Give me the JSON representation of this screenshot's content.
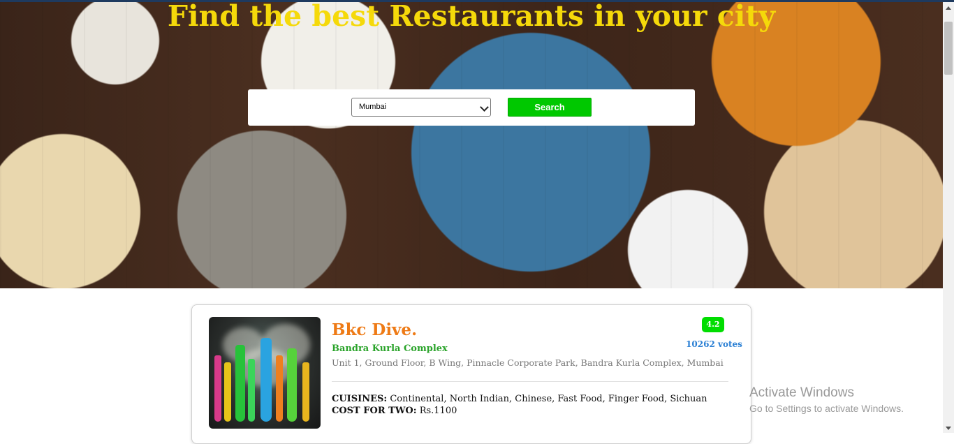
{
  "hero": {
    "title": "Find the best Restaurants in your city"
  },
  "search": {
    "selected_city": "Mumbai",
    "button_label": "Search"
  },
  "restaurant": {
    "name": "Bkc Dive.",
    "area": "Bandra Kurla Complex",
    "address": "Unit 1, Ground Floor, B Wing, Pinnacle Corporate Park, Bandra Kurla Complex, Mumbai",
    "rating": "4.2",
    "votes": "10262 votes",
    "cuisines_label": "CUISINES:",
    "cuisines": "Continental, North Indian, Chinese, Fast Food, Finger Food, Sichuan",
    "cost_label": "COST FOR TWO:",
    "cost": "Rs.1100"
  },
  "os_watermark": {
    "title": "Activate Windows",
    "subtitle": "Go to Settings to activate Windows."
  },
  "colors": {
    "title": "#f5d90a",
    "search_button": "#00c800",
    "restaurant_name": "#ee7a15",
    "area": "#29a329",
    "rating_badge": "#00dd00",
    "votes": "#2a7fd4"
  }
}
